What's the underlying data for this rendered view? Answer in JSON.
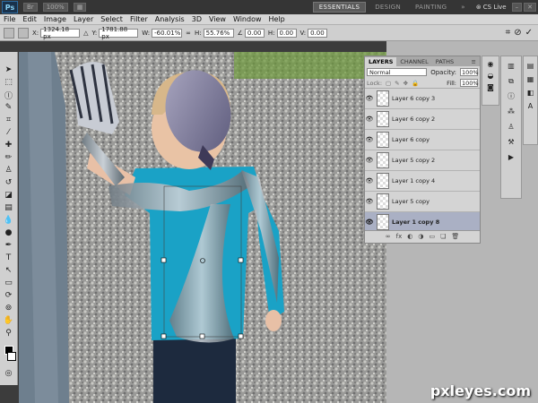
{
  "appbar": {
    "logo": "Ps",
    "zoom": "100%",
    "workspaces": [
      "ESSENTIALS",
      "DESIGN",
      "PAINTING"
    ],
    "more": "»",
    "cs_live": "CS Live"
  },
  "menu": [
    "File",
    "Edit",
    "Image",
    "Layer",
    "Select",
    "Filter",
    "Analysis",
    "3D",
    "View",
    "Window",
    "Help"
  ],
  "options": {
    "x_label": "X:",
    "x_value": "1324.18 px",
    "y_label": "Y:",
    "y_value": "1781.88 px",
    "w_label": "W:",
    "w_value": "-60.01%",
    "h_label": "H:",
    "h_value": "55.76%",
    "rot_value": "0.00",
    "hskew_label": "H:",
    "hskew_value": "0.00",
    "vskew_label": "V:",
    "vskew_value": "0.00"
  },
  "layers_panel": {
    "tabs": [
      "LAYERS",
      "CHANNEL",
      "PATHS"
    ],
    "blend_mode": "Normal",
    "opacity_label": "Opacity:",
    "opacity_value": "100%",
    "lock_label": "Lock:",
    "fill_label": "Fill:",
    "fill_value": "100%",
    "layers": [
      {
        "name": "Layer 6 copy 3",
        "visible": true,
        "selected": false
      },
      {
        "name": "Layer 6 copy 2",
        "visible": true,
        "selected": false
      },
      {
        "name": "Layer 6 copy",
        "visible": true,
        "selected": false
      },
      {
        "name": "Layer 5 copy 2",
        "visible": true,
        "selected": false
      },
      {
        "name": "Layer 1 copy 4",
        "visible": true,
        "selected": false
      },
      {
        "name": "Layer 5 copy",
        "visible": true,
        "selected": false
      },
      {
        "name": "Layer 1 copy 8",
        "visible": true,
        "selected": true
      }
    ]
  },
  "watermark": "pxleyes.com"
}
